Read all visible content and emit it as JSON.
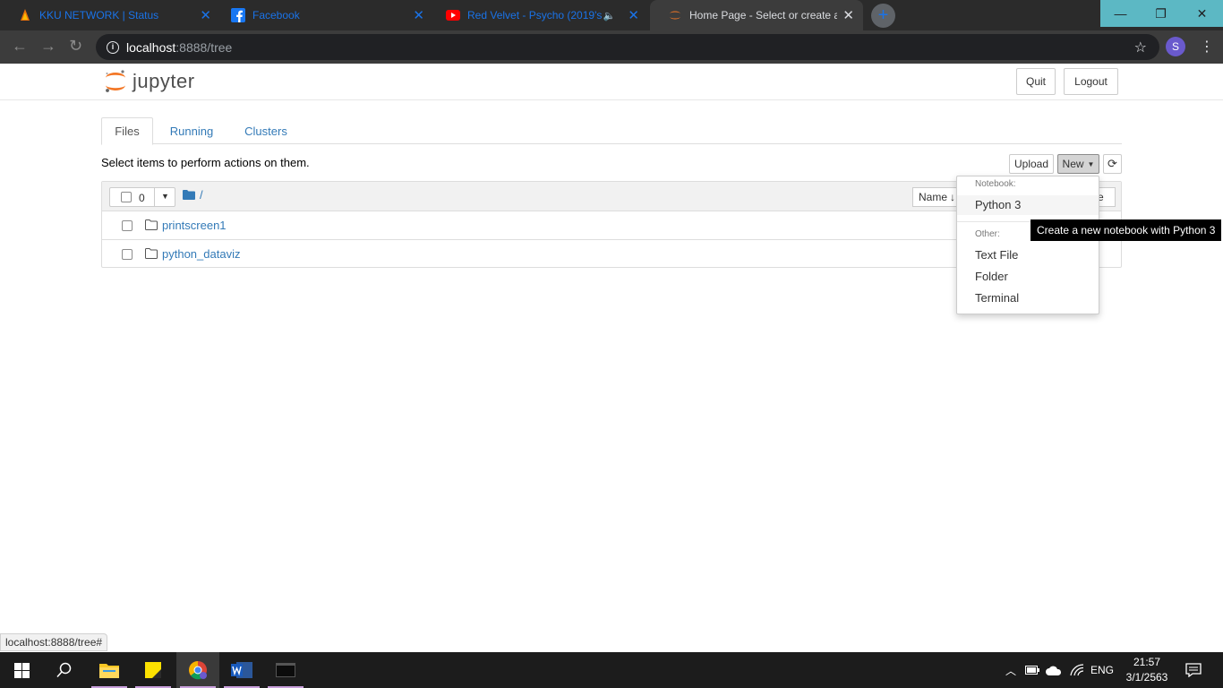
{
  "browser": {
    "tabs": [
      {
        "title": "KKU NETWORK | Status",
        "icon": "kku-icon",
        "active": false
      },
      {
        "title": "Facebook",
        "icon": "facebook-icon",
        "active": false
      },
      {
        "title": "Red Velvet - Psycho (2019's",
        "icon": "youtube-icon",
        "active": false,
        "muted": true
      },
      {
        "title": "Home Page - Select or create a n",
        "icon": "jupyter-icon",
        "active": true
      }
    ],
    "new_tab_label": "+",
    "address": {
      "host": "localhost",
      "path": ":8888/tree"
    },
    "profile_initial": "S"
  },
  "jupyter": {
    "wordmark": "jupyter",
    "quit_label": "Quit",
    "logout_label": "Logout",
    "tabs": [
      "Files",
      "Running",
      "Clusters"
    ],
    "instructions": "Select items to perform actions on them.",
    "upload_label": "Upload",
    "new_label": "New",
    "selected_count": "0",
    "breadcrumb": "/",
    "sort_name_label": "Name",
    "sort_size_label": "ze",
    "files": [
      {
        "name": "printscreen1",
        "type": "folder"
      },
      {
        "name": "python_dataviz",
        "type": "folder"
      }
    ]
  },
  "new_menu": {
    "notebook_header": "Notebook:",
    "notebook_items": [
      "Python 3"
    ],
    "other_header": "Other:",
    "other_items": [
      "Text File",
      "Folder",
      "Terminal"
    ]
  },
  "tooltip": "Create a new notebook with Python 3",
  "status_url": "localhost:8888/tree#",
  "taskbar": {
    "language": "ENG",
    "time": "21:57",
    "date": "3/1/2563"
  },
  "colors": {
    "link": "#337ab7",
    "jupyter_orange": "#f37726",
    "chrome_dark": "#2b2b2b"
  }
}
